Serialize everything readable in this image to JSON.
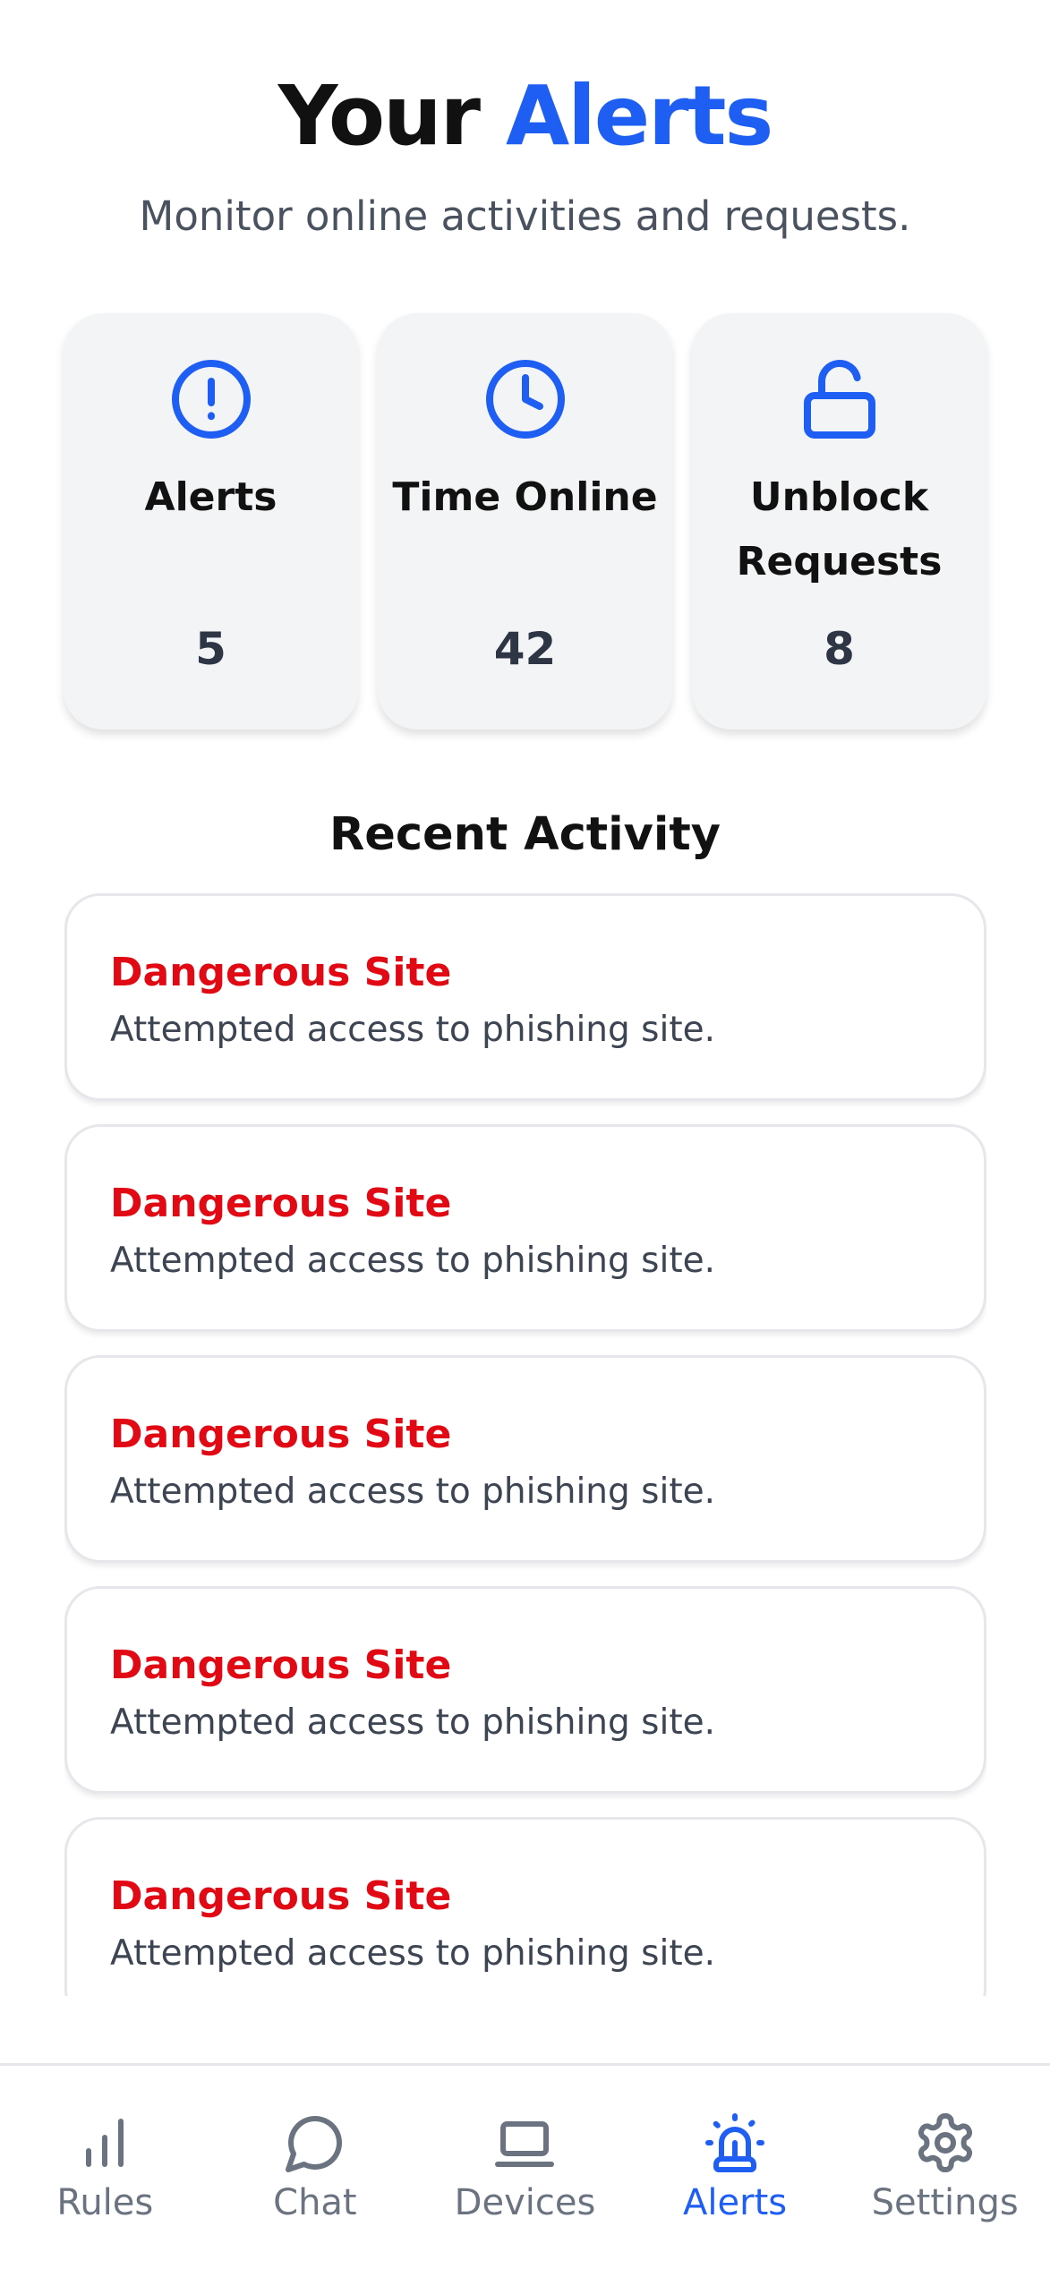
{
  "header": {
    "title_prefix": "Your",
    "title_accent": "Alerts",
    "subtitle": "Monitor online activities and requests."
  },
  "stats": [
    {
      "label": "Alerts",
      "value": "5",
      "icon": "alert-circle-icon"
    },
    {
      "label": "Time Online",
      "value": "42",
      "icon": "clock-icon"
    },
    {
      "label": "Unblock Requests",
      "value": "8",
      "icon": "unlock-icon"
    }
  ],
  "recent": {
    "title": "Recent Activity",
    "items": [
      {
        "title": "Dangerous Site",
        "description": "Attempted access to phishing site."
      },
      {
        "title": "Dangerous Site",
        "description": "Attempted access to phishing site."
      },
      {
        "title": "Dangerous Site",
        "description": "Attempted access to phishing site."
      },
      {
        "title": "Dangerous Site",
        "description": "Attempted access to phishing site."
      },
      {
        "title": "Dangerous Site",
        "description": "Attempted access to phishing site."
      }
    ]
  },
  "tabbar": {
    "items": [
      {
        "label": "Rules",
        "icon": "bar-chart-icon",
        "active": false
      },
      {
        "label": "Chat",
        "icon": "chat-bubble-icon",
        "active": false
      },
      {
        "label": "Devices",
        "icon": "laptop-icon",
        "active": false
      },
      {
        "label": "Alerts",
        "icon": "siren-icon",
        "active": true
      },
      {
        "label": "Settings",
        "icon": "gear-icon",
        "active": false
      }
    ]
  },
  "colors": {
    "accent": "#1f5ef2",
    "danger": "#e00914",
    "card_bg": "#f3f4f6",
    "muted": "#6b7280"
  }
}
